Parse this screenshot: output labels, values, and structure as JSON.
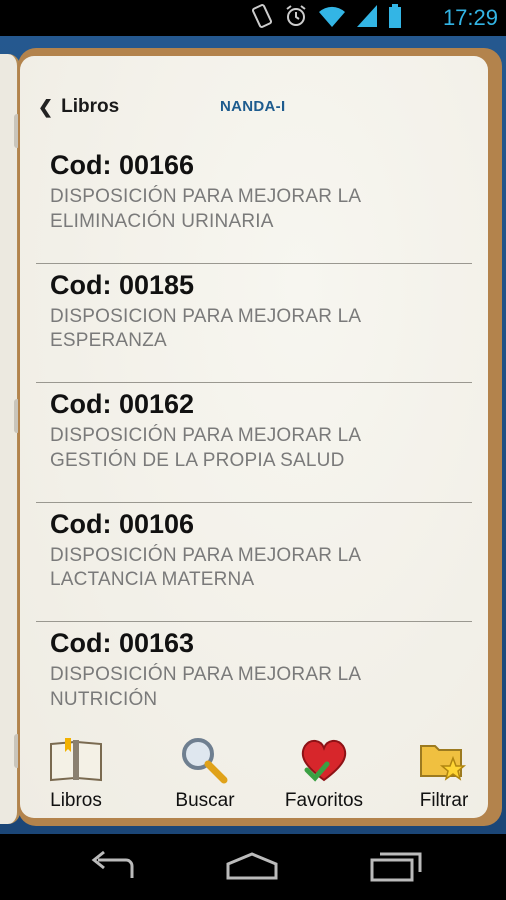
{
  "status_bar": {
    "time": "17:29",
    "icons": [
      "rotation-lock-icon",
      "alarm-icon",
      "wifi-icon",
      "signal-icon",
      "battery-icon"
    ],
    "accent_color": "#33b5e5"
  },
  "header": {
    "back_label": "Libros",
    "title": "NANDA-I"
  },
  "items": [
    {
      "code": "Cod: 00166",
      "desc_line1": "DISPOSICIÓN PARA MEJORAR LA",
      "desc_line2": "ELIMINACIÓN URINARIA"
    },
    {
      "code": "Cod: 00185",
      "desc_line1": "DISPOSICION PARA MEJORAR LA",
      "desc_line2": "ESPERANZA"
    },
    {
      "code": "Cod: 00162",
      "desc_line1": "DISPOSICIÓN PARA MEJORAR LA",
      "desc_line2": "GESTIÓN DE LA PROPIA SALUD"
    },
    {
      "code": "Cod: 00106",
      "desc_line1": "DISPOSICIÓN PARA MEJORAR LA",
      "desc_line2": "LACTANCIA MATERNA"
    },
    {
      "code": "Cod: 00163",
      "desc_line1": "DISPOSICIÓN PARA MEJORAR LA",
      "desc_line2": "NUTRICIÓN"
    }
  ],
  "tabs": {
    "libros": "Libros",
    "buscar": "Buscar",
    "favoritos": "Favoritos",
    "filtrar": "Filtrar"
  },
  "colors": {
    "frame_blue": "#1f4f86",
    "book_leather": "#b3834c",
    "title_blue": "#1d5b8e"
  }
}
